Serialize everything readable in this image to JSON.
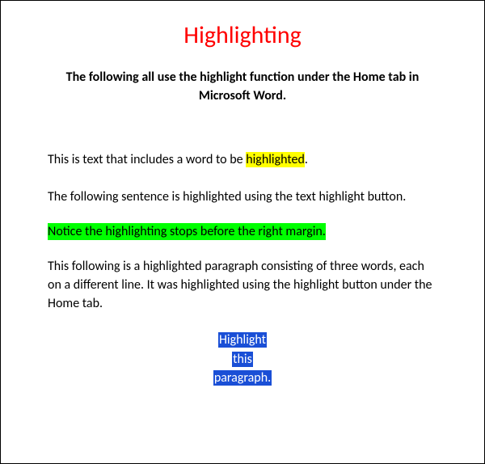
{
  "title": "Highlighting",
  "subtitle": "The following all use the highlight function under the Home tab in Microsoft Word.",
  "line1_before": "This is text that includes a word to be ",
  "line1_highlight": "highlighted",
  "line1_after": ".",
  "line2": "The following sentence is highlighted using the text highlight button.",
  "green_sentence": "Notice the highlighting stops before the right margin.",
  "line3": "This following is a highlighted paragraph consisting of three words, each on a different line. It was highlighted using the highlight button under the Home tab.",
  "blue_word1": "Highlight",
  "blue_word2": "this",
  "blue_word3": "paragraph.",
  "colors": {
    "title": "#ff0000",
    "yellow_highlight": "#ffff00",
    "green_highlight": "#00ff00",
    "blue_highlight": "#1a4fd6"
  }
}
